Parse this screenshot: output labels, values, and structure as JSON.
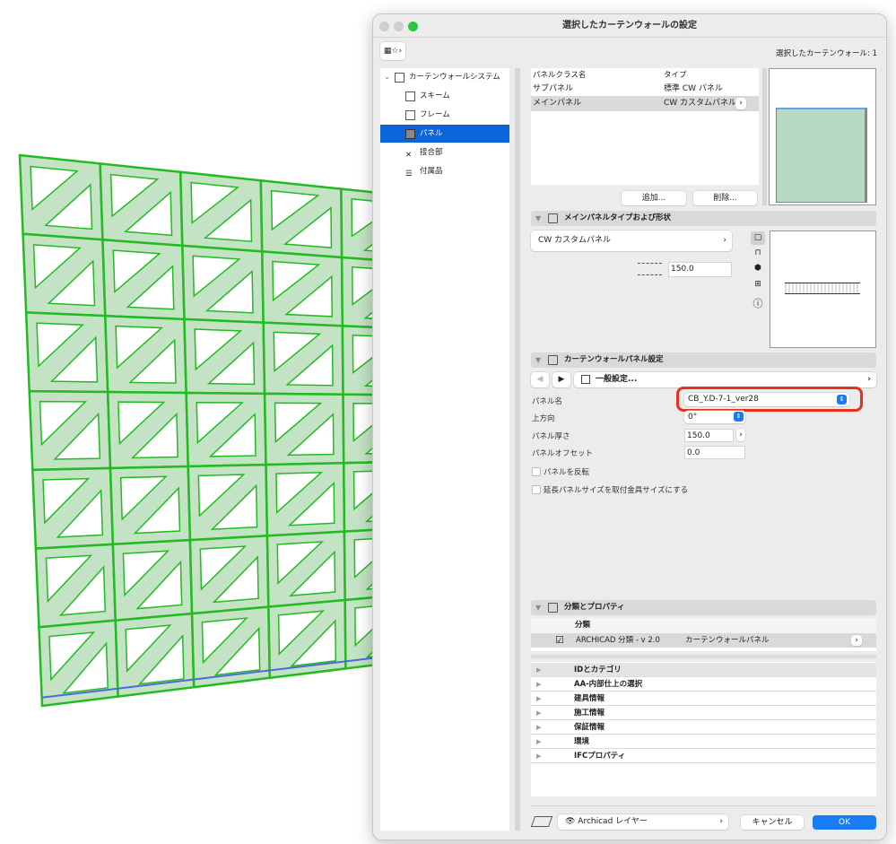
{
  "dialog": {
    "title": "選択したカーテンウォールの設定",
    "selected_count": "選択したカーテンウォール: 1"
  },
  "sidebar": {
    "items": [
      {
        "label": "カーテンウォールシステム",
        "icon": "grid-icon"
      },
      {
        "label": "スキーム",
        "icon": "scheme-icon"
      },
      {
        "label": "フレーム",
        "icon": "frame-icon"
      },
      {
        "label": "パネル",
        "icon": "panel-icon",
        "selected": true
      },
      {
        "label": "接合部",
        "icon": "junction-icon"
      },
      {
        "label": "付属品",
        "icon": "accessory-icon"
      }
    ]
  },
  "panel_table": {
    "headers": [
      "パネルクラス名",
      "タイプ"
    ],
    "rows": [
      {
        "name": "サブパネル",
        "type": "標準 CW パネル"
      },
      {
        "name": "メインパネル",
        "type": "CW カスタムパネル",
        "selected": true
      }
    ],
    "add_label": "追加...",
    "delete_label": "削除..."
  },
  "main_panel_section": {
    "title": "メインパネルタイプおよび形状",
    "type_value": "CW カスタムパネル",
    "thickness": "150.0"
  },
  "cw_panel_section": {
    "title": "カーテンウォールパネル設定",
    "page_label": "一般設定...",
    "fields": {
      "panel_name_label": "パネル名",
      "panel_name_value": "CB_Y.D-7-1_ver28",
      "up_direction_label": "上方向",
      "up_direction_value": "0°",
      "thickness_label": "パネル厚さ",
      "thickness_value": "150.0",
      "offset_label": "パネルオフセット",
      "offset_value": "0.0"
    },
    "flip_label": "パネルを反転",
    "extend_label": "延長パネルサイズを取付金具サイズにする"
  },
  "classification_section": {
    "title": "分類とプロパティ",
    "header": "分類",
    "row": {
      "system": "ARCHICAD 分類 - v 2.0",
      "value": "カーテンウォールパネル",
      "checked": true
    },
    "property_groups": [
      "IDとカテゴリ",
      "AA-内部仕上の選択",
      "建具情報",
      "施工情報",
      "保証情報",
      "環境",
      "IFCプロパティ"
    ]
  },
  "footer": {
    "layer": "Archicad レイヤー",
    "cancel": "キャンセル",
    "ok": "OK"
  },
  "colors": {
    "accent": "#1a7cf5",
    "highlight": "#e8301e",
    "wall_green": "#22bb22"
  }
}
